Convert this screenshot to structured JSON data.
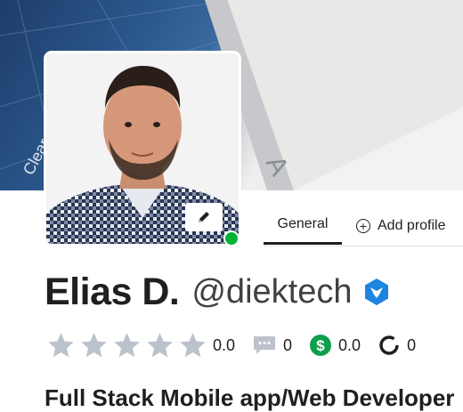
{
  "profile": {
    "name": "Elias D.",
    "username": "@diektech",
    "headline": "Full Stack Mobile app/Web Developer"
  },
  "tabs": [
    {
      "label": "General",
      "active": true
    },
    {
      "label": "Add profile",
      "active": false
    }
  ],
  "stats": {
    "rating": "0.0",
    "reviews": "0",
    "earnings": "0.0",
    "completion": "0"
  },
  "colors": {
    "online": "#00b336",
    "verified": "#1d84e0",
    "star": "#bcc2cc",
    "earnings": "#0e9f4b",
    "review_icon": "#bcc2cc"
  },
  "cover_text": [
    "Clear",
    "A"
  ]
}
